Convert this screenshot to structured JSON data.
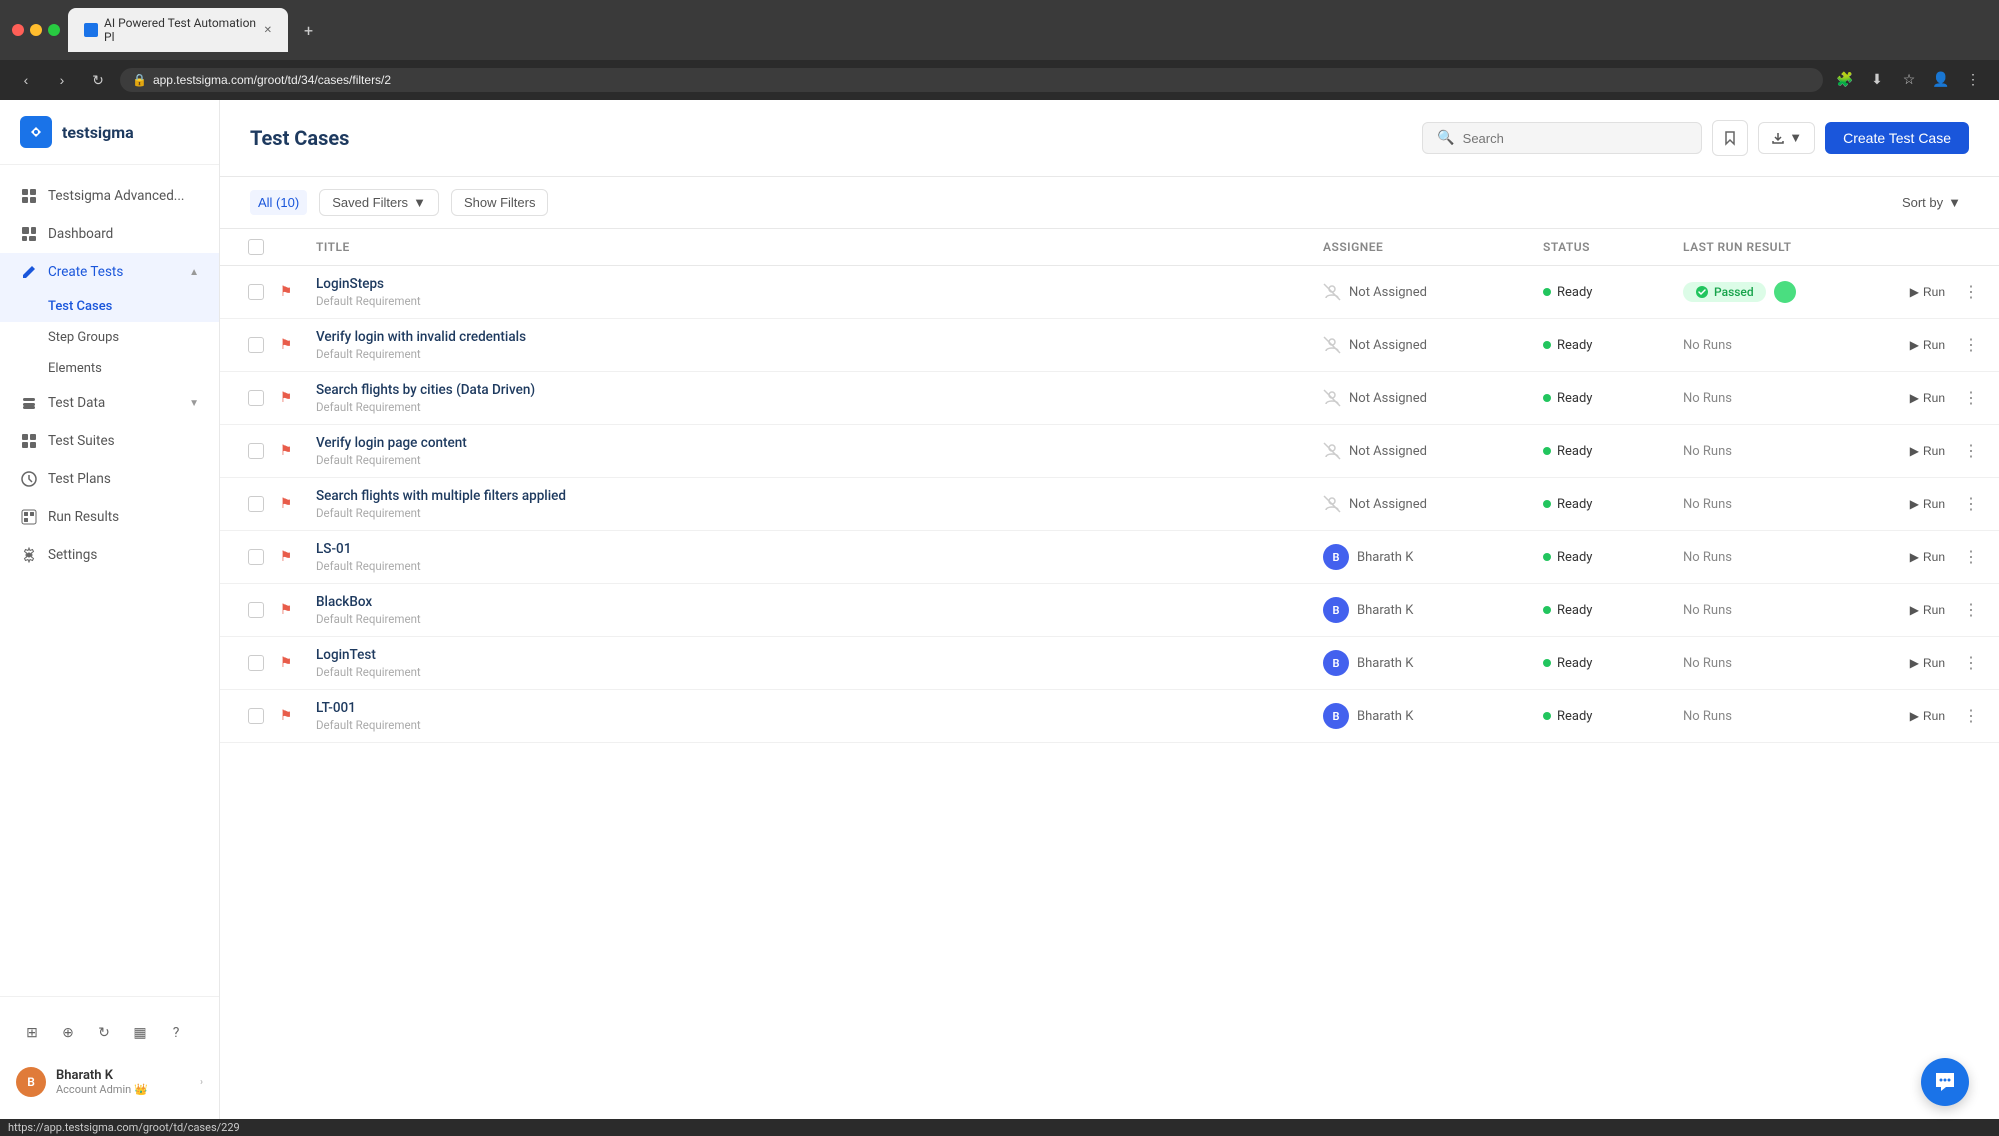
{
  "browser": {
    "tab_title": "AI Powered Test Automation Pl",
    "address": "app.testsigma.com/groot/td/34/cases/filters/2",
    "status_url": "https://app.testsigma.com/groot/td/cases/229"
  },
  "sidebar": {
    "logo_text": "testsigma",
    "nav_items": [
      {
        "id": "nav-grid",
        "label": "Testsigma Advanced...",
        "icon": "⊞",
        "has_chevron": false
      },
      {
        "id": "nav-dashboard",
        "label": "Dashboard",
        "icon": "◫",
        "has_chevron": false
      },
      {
        "id": "nav-create-tests",
        "label": "Create Tests",
        "icon": "✏",
        "has_chevron": true,
        "expanded": true
      },
      {
        "id": "nav-test-data",
        "label": "Test Data",
        "icon": "☰",
        "has_chevron": true
      },
      {
        "id": "nav-test-suites",
        "label": "Test Suites",
        "icon": "⊞",
        "has_chevron": false
      },
      {
        "id": "nav-test-plans",
        "label": "Test Plans",
        "icon": "⊕",
        "has_chevron": false
      },
      {
        "id": "nav-run-results",
        "label": "Run Results",
        "icon": "▦",
        "has_chevron": false
      },
      {
        "id": "nav-settings",
        "label": "Settings",
        "icon": "⚙",
        "has_chevron": false
      }
    ],
    "submenu_items": [
      {
        "id": "sub-test-cases",
        "label": "Test Cases",
        "active": true
      },
      {
        "id": "sub-step-groups",
        "label": "Step Groups"
      },
      {
        "id": "sub-elements",
        "label": "Elements"
      }
    ],
    "bottom_icons": [
      "⊞",
      "⊕",
      "↻",
      "▦",
      "?"
    ],
    "user": {
      "initials": "B",
      "name": "Bharath K",
      "role": "Account Admin",
      "emoji": "👑"
    }
  },
  "header": {
    "title": "Test Cases",
    "search_placeholder": "Search",
    "create_button_label": "Create Test Case"
  },
  "filters": {
    "all_label": "All (10)",
    "saved_filters_label": "Saved Filters",
    "show_filters_label": "Show Filters",
    "sort_by_label": "Sort by"
  },
  "table": {
    "columns": {
      "title": "Title",
      "assignee": "Assignee",
      "status": "Status",
      "last_run_result": "Last Run Result"
    },
    "rows": [
      {
        "id": "row-1",
        "name": "LoginSteps",
        "requirement": "Default Requirement",
        "assignee": "Not Assigned",
        "assignee_type": "none",
        "status": "Ready",
        "last_run": "Passed",
        "last_run_type": "passed"
      },
      {
        "id": "row-2",
        "name": "Verify login with invalid credentials",
        "requirement": "Default Requirement",
        "assignee": "Not Assigned",
        "assignee_type": "none",
        "status": "Ready",
        "last_run": "No Runs",
        "last_run_type": "no_runs"
      },
      {
        "id": "row-3",
        "name": "Search flights by cities (Data Driven)",
        "requirement": "Default Requirement",
        "assignee": "Not Assigned",
        "assignee_type": "none",
        "status": "Ready",
        "last_run": "No Runs",
        "last_run_type": "no_runs"
      },
      {
        "id": "row-4",
        "name": "Verify login page content",
        "requirement": "Default Requirement",
        "assignee": "Not Assigned",
        "assignee_type": "none",
        "status": "Ready",
        "last_run": "No Runs",
        "last_run_type": "no_runs"
      },
      {
        "id": "row-5",
        "name": "Search flights with multiple filters applied",
        "requirement": "Default Requirement",
        "assignee": "Not Assigned",
        "assignee_type": "none",
        "status": "Ready",
        "last_run": "No Runs",
        "last_run_type": "no_runs"
      },
      {
        "id": "row-6",
        "name": "LS-01",
        "requirement": "Default Requirement",
        "assignee": "Bharath K",
        "assignee_type": "user",
        "assignee_initials": "B",
        "status": "Ready",
        "last_run": "No Runs",
        "last_run_type": "no_runs"
      },
      {
        "id": "row-7",
        "name": "BlackBox",
        "requirement": "Default Requirement",
        "assignee": "Bharath K",
        "assignee_type": "user",
        "assignee_initials": "B",
        "status": "Ready",
        "last_run": "No Runs",
        "last_run_type": "no_runs"
      },
      {
        "id": "row-8",
        "name": "LoginTest",
        "requirement": "Default Requirement",
        "assignee": "Bharath K",
        "assignee_type": "user",
        "assignee_initials": "B",
        "status": "Ready",
        "last_run": "No Runs",
        "last_run_type": "no_runs"
      },
      {
        "id": "row-9",
        "name": "LT-001",
        "requirement": "Default Requirement",
        "assignee": "Bharath K",
        "assignee_type": "user",
        "assignee_initials": "B",
        "status": "Ready",
        "last_run": "No Runs",
        "last_run_type": "no_runs"
      }
    ],
    "run_label": "Run",
    "no_runs_label": "No Runs",
    "passed_label": "Passed",
    "ready_label": "Ready"
  },
  "colors": {
    "accent": "#1a56db",
    "logo_bg": "#1e3a5f",
    "flag": "#e85c4a",
    "avatar_orange": "#e07b39",
    "avatar_blue": "#4361ee",
    "passed_bg": "#dcfce7",
    "passed_text": "#16a34a",
    "ready_dot": "#22c55e"
  }
}
